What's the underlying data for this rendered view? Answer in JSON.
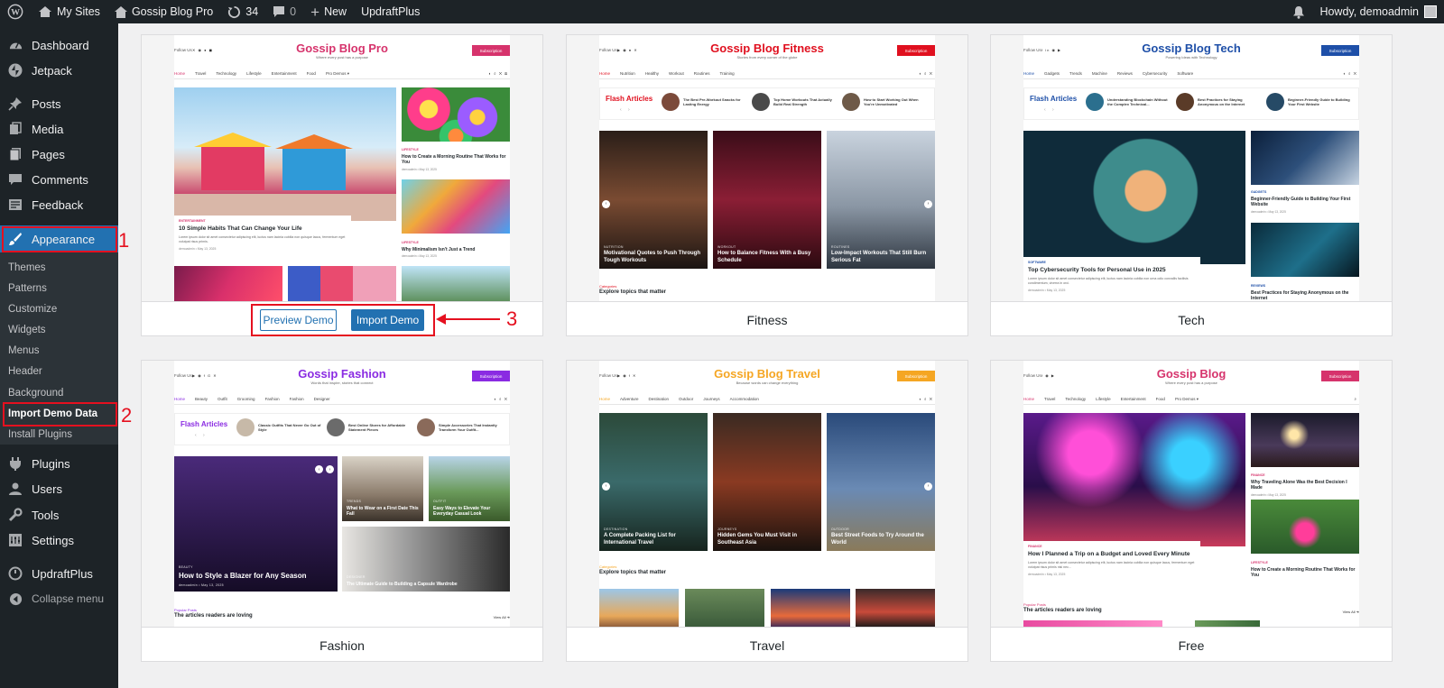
{
  "adminbar": {
    "my_sites": "My Sites",
    "site_name": "Gossip Blog Pro",
    "updates_count": "34",
    "comments_count": "0",
    "new_label": "New",
    "plugin_label": "UpdraftPlus",
    "greeting": "Howdy, demoadmin"
  },
  "sidebar": {
    "items": [
      {
        "label": "Dashboard",
        "icon": "dashboard-icon"
      },
      {
        "label": "Jetpack",
        "icon": "jetpack-icon"
      },
      {
        "label": "Posts",
        "icon": "pin-icon"
      },
      {
        "label": "Media",
        "icon": "media-icon"
      },
      {
        "label": "Pages",
        "icon": "pages-icon"
      },
      {
        "label": "Comments",
        "icon": "comment-icon"
      },
      {
        "label": "Feedback",
        "icon": "feedback-icon"
      },
      {
        "label": "Appearance",
        "icon": "brush-icon"
      },
      {
        "label": "Plugins",
        "icon": "plugin-icon"
      },
      {
        "label": "Users",
        "icon": "users-icon"
      },
      {
        "label": "Tools",
        "icon": "wrench-icon"
      },
      {
        "label": "Settings",
        "icon": "settings-icon"
      },
      {
        "label": "UpdraftPlus",
        "icon": "updraft-icon"
      },
      {
        "label": "Collapse menu",
        "icon": "collapse-icon"
      }
    ],
    "submenu": [
      "Themes",
      "Patterns",
      "Customize",
      "Widgets",
      "Menus",
      "Header",
      "Background",
      "Import Demo Data",
      "Install Plugins"
    ]
  },
  "annotations": [
    "1",
    "2",
    "3"
  ],
  "cards": [
    {
      "footer": "",
      "site_title": "Gossip Blog Pro",
      "tagline": "Where every post has a purpose",
      "follow": "Follow Us",
      "subscribe": "Subscription",
      "nav": [
        "Home",
        "Travel",
        "Technology",
        "Lifestyle",
        "Entertainment",
        "Food",
        "Pro Demos ▾"
      ],
      "main_post": {
        "cat": "ENTERTAINMENT",
        "title": "10 Simple Habits That Can Change Your Life",
        "excerpt": "Lorem ipsum dolor sit amet consectetur adipiscing elit, luctus nam lacinia cubilia non quisque lacus, fermentum eget volutpat risus primis.",
        "meta": "demoadmin  •  May 13, 2025"
      },
      "side_posts": [
        {
          "cat": "LIFESTYLE",
          "title": "How to Create a Morning Routine That Works for You",
          "meta": "demoadmin  •  May 13, 2025"
        },
        {
          "cat": "LIFESTYLE",
          "title": "Why Minimalism Isn't Just a Trend",
          "meta": "demoadmin  •  May 13, 2025"
        }
      ],
      "preview_btn": "Preview Demo",
      "import_btn": "Import Demo"
    },
    {
      "footer": "Fitness",
      "site_title": "Gossip Blog Fitness",
      "tagline": "Stories from every corner of the globe",
      "follow": "Follow Us",
      "subscribe": "Subscription",
      "nav": [
        "Home",
        "Nutrition",
        "Healthy",
        "Workout",
        "Routines",
        "Training"
      ],
      "flash_title": "Flash Articles",
      "flash": [
        "The Best Pre-Workout Snacks for Lasting Energy",
        "Top Home Workouts That Actually Build Real Strength",
        "How to Start Working Out When You're Unmotivated"
      ],
      "tiles": [
        {
          "cat": "NUTRITION",
          "title": "Motivational Quotes to Push Through Tough Workouts"
        },
        {
          "cat": "WORKOUT",
          "title": "How to Balance Fitness With a Busy Schedule"
        },
        {
          "cat": "ROUTINES",
          "title": "Low-Impact Workouts That Still Burn Serious Fat"
        }
      ],
      "sec_label": "Categories",
      "sec_title": "Explore topics that matter"
    },
    {
      "footer": "Tech",
      "site_title": "Gossip Blog Tech",
      "tagline": "Powering Ideas with Technology",
      "follow": "Follow Us",
      "subscribe": "Subscription",
      "nav": [
        "Home",
        "Gadgets",
        "Trends",
        "Machine",
        "Reviews",
        "Cybersecurity",
        "Software"
      ],
      "flash_title": "Flash Articles",
      "flash": [
        "Understanding Blockchain Without the Complex Technical...",
        "Best Practices for Staying Anonymous on the Internet",
        "Beginner-Friendly Guide to Building Your First Website"
      ],
      "main_post": {
        "cat": "SOFTWARE",
        "title": "Top Cybersecurity Tools for Personal Use in 2025",
        "excerpt": "Lorem ipsum dolor sit amet consectetur adipiscing elit, luctus nam lacinia cubilia non urna odio convallis facilisis condimentum, viverra in orci.",
        "meta": "demoadmin  •  May 13, 2025"
      },
      "side_posts": [
        {
          "cat": "GADGETS",
          "title": "Beginner-Friendly Guide to Building Your First Website",
          "meta": "demoadmin  •  May 13, 2025"
        },
        {
          "cat": "REVIEWS",
          "title": "Best Practices for Staying Anonymous on the Internet",
          "meta": ""
        }
      ]
    },
    {
      "footer": "Fashion",
      "site_title": "Gossip Fashion",
      "tagline": "Words that inspire, stories that connect",
      "follow": "Follow Us",
      "subscribe": "Subscription",
      "nav": [
        "Home",
        "Beauty",
        "Outfit",
        "Grooming",
        "Fashion",
        "Fashion",
        "Designer"
      ],
      "flash_title": "Flash Articles",
      "flash": [
        "Classic Outfits That Never Go Out of Style",
        "Best Online Stores for Affordable Statement Pieces",
        "Simple Accessories That Instantly Transform Your Outfit..."
      ],
      "main_tile": {
        "cat": "BEAUTY",
        "title": "How to Style a Blazer for Any Season",
        "meta": "demoadmin  •  May 13, 2025"
      },
      "tiles": [
        {
          "cat": "TRENDS",
          "title": "What to Wear on a First Date This Fall"
        },
        {
          "cat": "OUTFIT",
          "title": "Easy Ways to Elevate Your Everyday Casual Look"
        },
        {
          "cat": "DESIGNER",
          "title": "The Ultimate Guide to Building a Capsule Wardrobe"
        }
      ],
      "sec_label": "Popular Posts",
      "sec_title": "The articles readers are loving",
      "view_all": "View All ➜"
    },
    {
      "footer": "Travel",
      "site_title": "Gossip Blog Travel",
      "tagline": "Because words can change everything",
      "follow": "Follow Us",
      "subscribe": "Subscription",
      "nav": [
        "Home",
        "Adventure",
        "Destination",
        "Outdoor",
        "Journeys",
        "Accommodation"
      ],
      "tiles": [
        {
          "cat": "DESTINATION",
          "title": "A Complete Packing List for International Travel"
        },
        {
          "cat": "JOURNEYS",
          "title": "Hidden Gems You Must Visit in Southeast Asia"
        },
        {
          "cat": "OUTDOOR",
          "title": "Best Street Foods to Try Around the World"
        }
      ],
      "sec_label": "Categories",
      "sec_title": "Explore topics that matter"
    },
    {
      "footer": "Free",
      "site_title": "Gossip Blog",
      "tagline": "Where every post has a purpose",
      "follow": "Follow Us",
      "subscribe": "Subscription",
      "nav": [
        "Home",
        "Travel",
        "Technology",
        "Lifestyle",
        "Entertainment",
        "Food",
        "Pro Demos ▾"
      ],
      "main_post": {
        "cat": "FINANCE",
        "title": "How I Planned a Trip on a Budget and Loved Every Minute",
        "excerpt": "Lorem ipsum dolor sit amet consectetur adipiscing elit, luctus nam lacinia cubilia non quisque lacus, fermentum eget volutpat risus primis nisi nec...",
        "meta": "demoadmin  •  May 13, 2025"
      },
      "side_posts": [
        {
          "cat": "FINANCE",
          "title": "Why Traveling Alone Was the Best Decision I Made",
          "meta": "demoadmin  •  May 13, 2025"
        },
        {
          "cat": "LIFESTYLE",
          "title": "How to Create a Morning Routine That Works for You",
          "meta": ""
        }
      ],
      "sec_label": "Popular Posts",
      "sec_title": "The articles readers are loving",
      "view_all": "View All ➜"
    }
  ],
  "colors": {
    "admin_dark": "#1d2327",
    "accent_blue": "#2271b1",
    "annotation_red": "#e5101f",
    "pro_title": "#d6336c",
    "fitness_title": "#e0101f",
    "tech_title": "#1e4fa8",
    "fashion_title": "#8a2be2",
    "travel_title": "#f5a623",
    "free_title": "#d6336c"
  }
}
